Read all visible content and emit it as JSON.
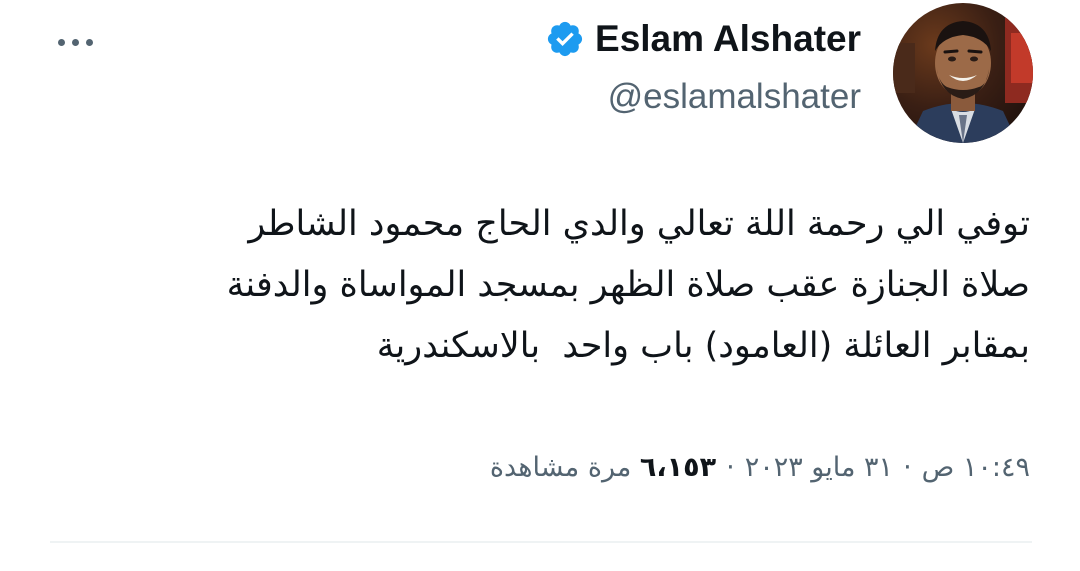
{
  "author": {
    "display_name": "Eslam Alshater",
    "handle": "@eslamalshater",
    "verified_icon": "verified-badge",
    "verified_color": "#1d9bf0"
  },
  "tweet": {
    "lines": [
      "توفي الي رحمة اللة تعالي والدي الحاج محمود الشاطر",
      "صلاة الجنازة عقب صلاة الظهر بمسجد المواساة والدفنة",
      "بمقابر العائلة (العامود) باب واحد  بالاسكندرية"
    ]
  },
  "meta": {
    "time": "١٠:٤٩ ص",
    "separator": "·",
    "date": "٣١ مايو ٢٠٢٣",
    "views_count": "٦،١٥٣",
    "views_label": "مرة مشاهدة"
  },
  "actions": {
    "more_icon": "more-horizontal-icon"
  }
}
